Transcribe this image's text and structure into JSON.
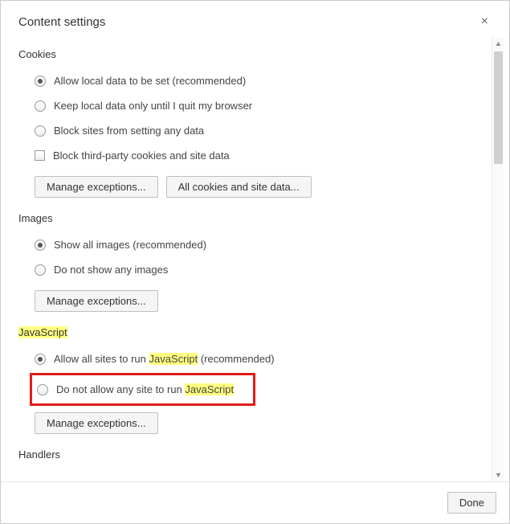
{
  "title": "Content settings",
  "sections": {
    "cookies": {
      "title": "Cookies",
      "options": [
        "Allow local data to be set (recommended)",
        "Keep local data only until I quit my browser",
        "Block sites from setting any data"
      ],
      "checkbox": "Block third-party cookies and site data",
      "buttons": {
        "manage": "Manage exceptions...",
        "alldata": "All cookies and site data..."
      }
    },
    "images": {
      "title": "Images",
      "options": [
        "Show all images (recommended)",
        "Do not show any images"
      ],
      "buttons": {
        "manage": "Manage exceptions..."
      }
    },
    "javascript": {
      "title_pre": "",
      "title_hl": "JavaScript",
      "opt1_pre": "Allow all sites to run ",
      "opt1_hl": "JavaScript",
      "opt1_post": " (recommended)",
      "opt2_pre": "Do not allow any site to run ",
      "opt2_hl": "JavaScript",
      "buttons": {
        "manage": "Manage exceptions..."
      }
    },
    "handlers": {
      "title": "Handlers"
    }
  },
  "footer": {
    "done": "Done"
  }
}
